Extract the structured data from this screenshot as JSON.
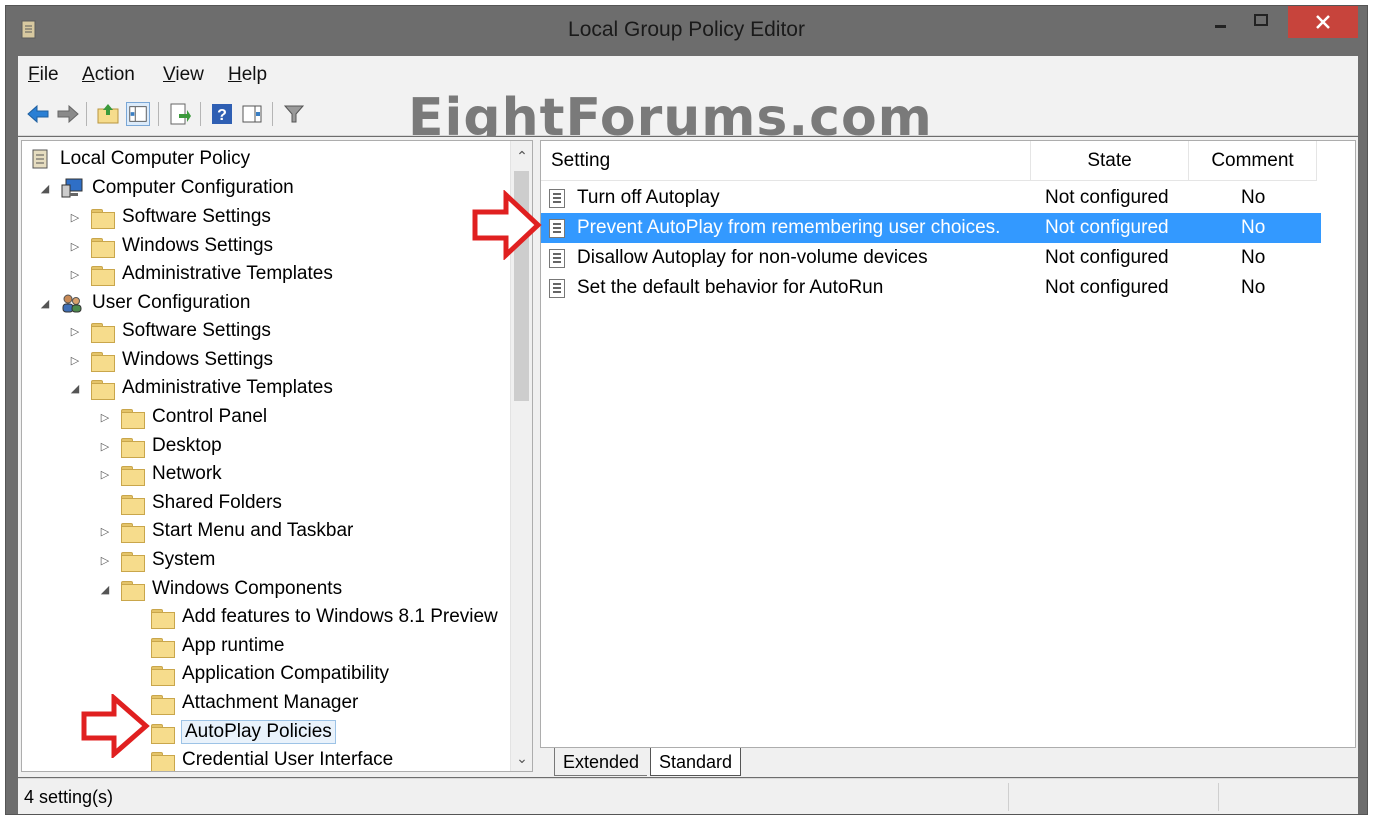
{
  "window": {
    "title": "Local Group Policy Editor"
  },
  "menu": {
    "items": [
      {
        "label_ul": "F",
        "label_rest": "ile"
      },
      {
        "label_ul": "A",
        "label_rest": "ction"
      },
      {
        "label_ul": "V",
        "label_rest": "iew"
      },
      {
        "label_ul": "H",
        "label_rest": "elp"
      }
    ]
  },
  "watermark": "EightForums.com",
  "tree": {
    "root": "Local Computer Policy",
    "computer_config": "Computer Configuration",
    "cc_software": "Software Settings",
    "cc_windows": "Windows Settings",
    "cc_admin": "Administrative Templates",
    "user_config": "User Configuration",
    "uc_software": "Software Settings",
    "uc_windows": "Windows Settings",
    "uc_admin": "Administrative Templates",
    "control_panel": "Control Panel",
    "desktop": "Desktop",
    "network": "Network",
    "shared_folders": "Shared Folders",
    "start_menu": "Start Menu and Taskbar",
    "system": "System",
    "windows_components": "Windows Components",
    "add_features": "Add features to Windows 8.1 Preview",
    "app_runtime": "App runtime",
    "app_compat": "Application Compatibility",
    "attachment_mgr": "Attachment Manager",
    "autoplay": "AutoPlay Policies",
    "credential_ui": "Credential User Interface"
  },
  "list": {
    "headers": {
      "setting": "Setting",
      "state": "State",
      "comment": "Comment"
    },
    "rows": [
      {
        "setting": "Turn off Autoplay",
        "state": "Not configured",
        "comment": "No"
      },
      {
        "setting": "Prevent AutoPlay from remembering user choices.",
        "state": "Not configured",
        "comment": "No"
      },
      {
        "setting": "Disallow Autoplay for non-volume devices",
        "state": "Not configured",
        "comment": "No"
      },
      {
        "setting": "Set the default behavior for AutoRun",
        "state": "Not configured",
        "comment": "No"
      }
    ]
  },
  "tabs": {
    "extended": "Extended",
    "standard": "Standard"
  },
  "status": {
    "text": "4 setting(s)"
  },
  "colors": {
    "selection": "#3399ff",
    "close": "#c7443c",
    "annotation_arrow": "#e02020"
  }
}
